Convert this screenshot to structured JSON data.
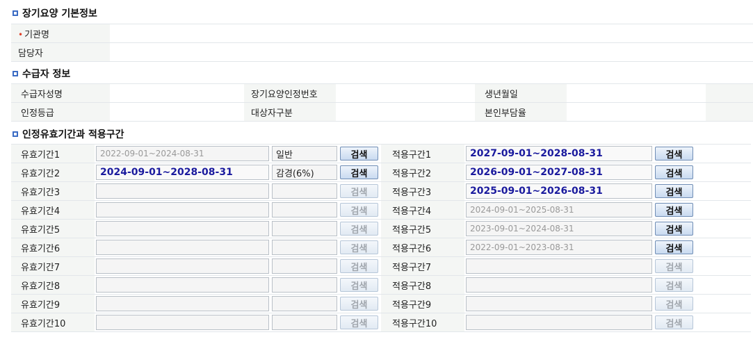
{
  "sections": {
    "basic": "장기요양 기본정보",
    "recipient": "수급자 정보",
    "period": "인정유효기간과 적용구간"
  },
  "basic": {
    "institution_label": "기관명",
    "manager_label": "담당자",
    "required_mark": "•"
  },
  "recipient": {
    "name_label": "수급자성명",
    "cert_no_label": "장기요양인정번호",
    "birth_label": "생년월일",
    "grade_label": "인정등급",
    "target_label": "대상자구분",
    "copay_label": "본인부담율"
  },
  "search_label": "검색",
  "rows": [
    {
      "label": "유효기간1",
      "period": "2022-09-01~2024-08-31",
      "period_bold": false,
      "type": "일반",
      "btn_enabled": true,
      "apply_label": "적용구간1",
      "apply": "2027-09-01~2028-08-31",
      "apply_bold": true,
      "apply_btn_enabled": true
    },
    {
      "label": "유효기간2",
      "period": "2024-09-01~2028-08-31",
      "period_bold": true,
      "type": "감경(6%)",
      "btn_enabled": true,
      "apply_label": "적용구간2",
      "apply": "2026-09-01~2027-08-31",
      "apply_bold": true,
      "apply_btn_enabled": true
    },
    {
      "label": "유효기간3",
      "period": "",
      "period_bold": false,
      "type": "",
      "btn_enabled": false,
      "apply_label": "적용구간3",
      "apply": "2025-09-01~2026-08-31",
      "apply_bold": true,
      "apply_btn_enabled": true
    },
    {
      "label": "유효기간4",
      "period": "",
      "period_bold": false,
      "type": "",
      "btn_enabled": false,
      "apply_label": "적용구간4",
      "apply": "2024-09-01~2025-08-31",
      "apply_bold": false,
      "apply_btn_enabled": true
    },
    {
      "label": "유효기간5",
      "period": "",
      "period_bold": false,
      "type": "",
      "btn_enabled": false,
      "apply_label": "적용구간5",
      "apply": "2023-09-01~2024-08-31",
      "apply_bold": false,
      "apply_btn_enabled": true
    },
    {
      "label": "유효기간6",
      "period": "",
      "period_bold": false,
      "type": "",
      "btn_enabled": false,
      "apply_label": "적용구간6",
      "apply": "2022-09-01~2023-08-31",
      "apply_bold": false,
      "apply_btn_enabled": true
    },
    {
      "label": "유효기간7",
      "period": "",
      "period_bold": false,
      "type": "",
      "btn_enabled": false,
      "apply_label": "적용구간7",
      "apply": "",
      "apply_bold": false,
      "apply_btn_enabled": false
    },
    {
      "label": "유효기간8",
      "period": "",
      "period_bold": false,
      "type": "",
      "btn_enabled": false,
      "apply_label": "적용구간8",
      "apply": "",
      "apply_bold": false,
      "apply_btn_enabled": false
    },
    {
      "label": "유효기간9",
      "period": "",
      "period_bold": false,
      "type": "",
      "btn_enabled": false,
      "apply_label": "적용구간9",
      "apply": "",
      "apply_bold": false,
      "apply_btn_enabled": false
    },
    {
      "label": "유효기간10",
      "period": "",
      "period_bold": false,
      "type": "",
      "btn_enabled": false,
      "apply_label": "적용구간10",
      "apply": "",
      "apply_bold": false,
      "apply_btn_enabled": false
    }
  ]
}
